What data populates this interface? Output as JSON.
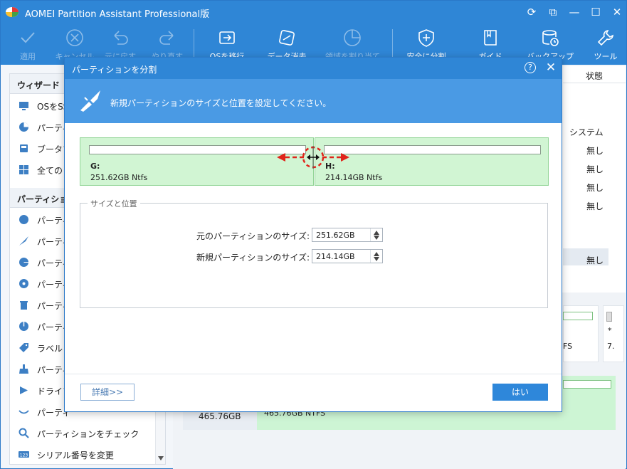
{
  "app": {
    "title": "AOMEI Partition Assistant Professional版",
    "colors": {
      "titlebar": "#2f86d6",
      "banner": "#4a9ae4",
      "partition_fill": "#d1f5d3",
      "arrow": "#e0241b"
    }
  },
  "toolbar": {
    "items": [
      {
        "label": "適用",
        "icon": "check-icon",
        "enabled": false
      },
      {
        "label": "キャンセル",
        "icon": "cancel-icon",
        "enabled": false
      },
      {
        "label": "元に戻す",
        "icon": "undo-icon",
        "enabled": false
      },
      {
        "label": "やり直す",
        "icon": "redo-icon",
        "enabled": false
      },
      {
        "label": "OSを移行",
        "icon": "migrate-os-icon",
        "enabled": true
      },
      {
        "label": "データ消去",
        "icon": "wipe-data-icon",
        "enabled": true
      },
      {
        "label": "領域を割り当てる",
        "icon": "allocate-space-icon",
        "enabled": false
      },
      {
        "label": "安全に分割",
        "icon": "shield-icon",
        "enabled": true
      },
      {
        "label": "ガイド",
        "icon": "guide-icon",
        "enabled": true
      },
      {
        "label": "バックアップ",
        "icon": "backup-icon",
        "enabled": true
      },
      {
        "label": "ツール",
        "icon": "tools-icon",
        "enabled": true
      }
    ]
  },
  "sidebar": {
    "wizard_header": "ウィザード",
    "wizard_items": [
      {
        "label": "OSをSSD",
        "icon": "migrate-ssd-icon"
      },
      {
        "label": "パーティ",
        "icon": "partition-recovery-icon"
      },
      {
        "label": "ブータブ",
        "icon": "bootable-media-icon"
      },
      {
        "label": "全ての",
        "icon": "all-tools-icon"
      }
    ],
    "partition_header": "パーティショ",
    "partition_items": [
      {
        "label": "パーティ",
        "icon": "resize-partition-icon"
      },
      {
        "label": "パーティ",
        "icon": "split-partition-icon"
      },
      {
        "label": "パーティ",
        "icon": "allocate-partition-icon"
      },
      {
        "label": "パーティ",
        "icon": "merge-partition-icon"
      },
      {
        "label": "パーティ",
        "icon": "delete-partition-icon"
      },
      {
        "label": "パーティ",
        "icon": "format-partition-icon"
      },
      {
        "label": "ラベル",
        "icon": "label-icon"
      },
      {
        "label": "パーティ",
        "icon": "wipe-partition-icon"
      },
      {
        "label": "ドライブ",
        "icon": "drive-letter-icon"
      },
      {
        "label": "パーティ",
        "icon": "hide-partition-icon"
      },
      {
        "label": "パーティションをチェック",
        "icon": "check-partition-icon"
      },
      {
        "label": "シリアル番号を変更",
        "icon": "serial-number-icon"
      }
    ]
  },
  "table": {
    "status_header": "状態",
    "status_values": [
      "システム",
      "無し",
      "無し",
      "無し",
      "無し"
    ],
    "selected_status": "無し"
  },
  "disk_map": {
    "disk_size": "465.76GB",
    "partition_text": "465.76GB NTFS",
    "small_label_1": "FS",
    "small_label_2": "*",
    "small_label_3": "7."
  },
  "dialog": {
    "title": "パーティションを分割",
    "help": "?",
    "banner_text": "新規パーティションのサイズと位置を設定してください。",
    "partition_left": {
      "letter": "G:",
      "info": "251.62GB Ntfs"
    },
    "partition_right": {
      "letter": "H:",
      "info": "214.14GB Ntfs"
    },
    "fieldset_label": "サイズと位置",
    "original_size_label": "元のパーティションのサイズ:",
    "original_size_value": "251.62GB",
    "new_size_label": "新規パーティションのサイズ:",
    "new_size_value": "214.14GB",
    "detail_button": "詳細>>",
    "ok_button": "はい"
  }
}
